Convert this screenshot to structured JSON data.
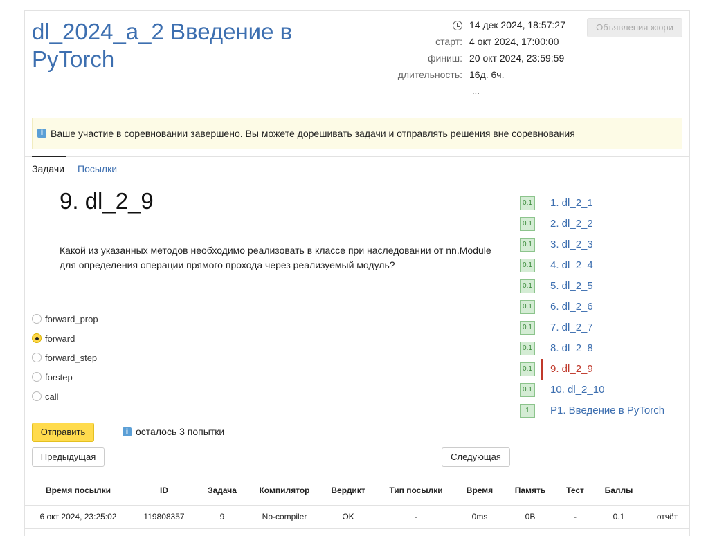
{
  "header": {
    "title": "dl_2024_a_2 Введение в PyTorch",
    "now_time": "14 дек 2024, 18:57:27",
    "start_label": "старт:",
    "start_value": "4 окт 2024, 17:00:00",
    "finish_label": "финиш:",
    "finish_value": "20 окт 2024, 23:59:59",
    "duration_label": "длительность:",
    "duration_value": "16д. 6ч.",
    "more": "...",
    "jury_button": "Объявления жюри"
  },
  "notice": {
    "icon": "info-icon",
    "text": "Ваше участие в соревновании завершено. Вы можете дорешивать задачи и отправлять решения вне соревнования"
  },
  "tabs": [
    {
      "label": "Задачи",
      "active": true
    },
    {
      "label": "Посылки",
      "active": false
    }
  ],
  "problem": {
    "title": "9. dl_2_9",
    "statement": "Какой из указанных методов необходимо реализовать в классе при наследовании от nn.Module для определения операции прямого прохода через реализуемый модуль?"
  },
  "options": [
    {
      "label": "forward_prop",
      "checked": false
    },
    {
      "label": "forward",
      "checked": true
    },
    {
      "label": "forward_step",
      "checked": false
    },
    {
      "label": "forstep",
      "checked": false
    },
    {
      "label": "call",
      "checked": false
    }
  ],
  "actions": {
    "submit": "Отправить",
    "attempts": "осталось 3 попытки",
    "prev": "Предыдущая",
    "next": "Следующая"
  },
  "problem_list": [
    {
      "badge": "0.1",
      "label": "1. dl_2_1",
      "active": false
    },
    {
      "badge": "0.1",
      "label": "2. dl_2_2",
      "active": false
    },
    {
      "badge": "0.1",
      "label": "3. dl_2_3",
      "active": false
    },
    {
      "badge": "0.1",
      "label": "4. dl_2_4",
      "active": false
    },
    {
      "badge": "0.1",
      "label": "5. dl_2_5",
      "active": false
    },
    {
      "badge": "0.1",
      "label": "6. dl_2_6",
      "active": false
    },
    {
      "badge": "0.1",
      "label": "7. dl_2_7",
      "active": false
    },
    {
      "badge": "0.1",
      "label": "8. dl_2_8",
      "active": false
    },
    {
      "badge": "0.1",
      "label": "9. dl_2_9",
      "active": true
    },
    {
      "badge": "0.1",
      "label": "10. dl_2_10",
      "active": false
    },
    {
      "badge": "1",
      "label": "P1. Введение в PyTorch",
      "active": false
    }
  ],
  "submissions": {
    "columns": [
      "Время посылки",
      "ID",
      "Задача",
      "Компилятор",
      "Вердикт",
      "Тип посылки",
      "Время",
      "Память",
      "Тест",
      "Баллы",
      ""
    ],
    "rows": [
      [
        "6 окт 2024, 23:25:02",
        "119808357",
        "9",
        "No-compiler",
        "OK",
        "-",
        "0ms",
        "0B",
        "-",
        "0.1",
        "отчёт"
      ]
    ]
  },
  "colors": {
    "link": "#3d6fb0",
    "accent": "#ffdb4d",
    "active_problem": "#c0392b",
    "verdict_ok": "#2e8b2e"
  }
}
